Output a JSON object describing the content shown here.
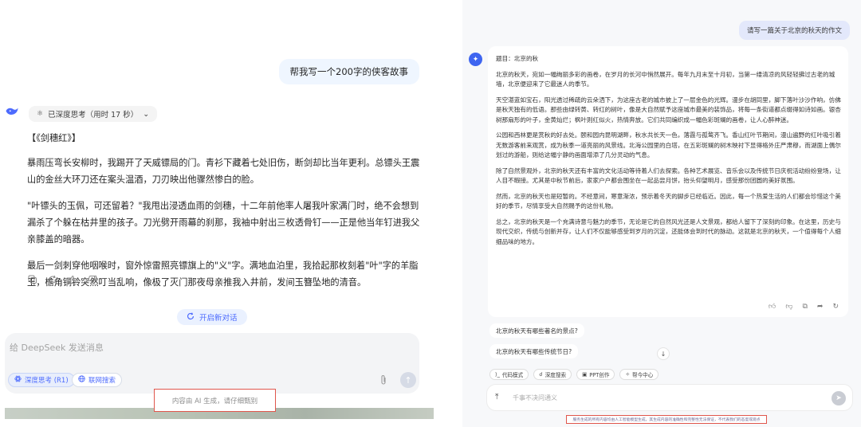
{
  "left": {
    "user_message": "帮我写一个200字的侠客故事",
    "think_chip": {
      "icon": "atom-icon",
      "label": "已深度思考（用时 17 秒）",
      "chevron": "⌄"
    },
    "answer": {
      "title": "【《剑穗红》】",
      "paragraphs": [
        "暴雨压弯长安柳时，我踢开了天威镖局的门。青衫下藏着七处旧伤，断剑却比当年更利。总镖头王震山的金丝大环刀还在案头温酒，刀刃映出他骤然惨白的脸。",
        "\"叶镖头的玉佩，可还留着？\"我甩出浸透血雨的剑穗，十二年前他率人屠我叶家满门时，绝不会想到漏杀了个躲在枯井里的孩子。刀光劈开雨幕的刹那，我袖中射出三枚透骨钉——正是他当年钉进我父亲膝盖的暗器。",
        "最后一剑刺穿他咽喉时，窗外惊雷照亮镖旗上的\"义\"字。满地血泊里，我拾起那枚刻着\"叶\"字的羊脂玉，檐角铜铃突然叮当乱响，像极了灭门那夜母亲推我入井前，发间玉簪坠地的清音。"
      ]
    },
    "actions": [
      "copy-icon",
      "regenerate-icon",
      "thumbs-up-icon",
      "thumbs-down-icon"
    ],
    "new_chat_label": "开启新对话",
    "composer": {
      "placeholder": "给 DeepSeek 发送消息",
      "deep_think_label": "深度思考 (R1)",
      "web_search_label": "联网搜索"
    },
    "disclaimer": "内容由 AI 生成，请仔细甄别"
  },
  "right": {
    "user_message": "请写一篇关于北京的秋天的作文",
    "paragraphs": [
      "题目：北京的秋",
      "北京的秋天，宛如一幅绚丽多彩的画卷，在岁月的长河中悄然展开。每年九月末至十月初，当第一缕清凉的风轻轻拂过古老的城墙，北京便迎来了它最迷人的季节。",
      "天空湛蓝如宝石，阳光透过稀疏的云朵洒下，为这座古老的城市披上了一层金色的光辉。漫步在胡同里，脚下落叶沙沙作响，仿佛是秋天独有的低语。那些由绿转黄、转红的树叶，像是大自然赋予这座城市最美的装饰品，将每一条街道都点缀得如诗如画。银杏树那扇形的叶子，金黄灿烂；枫叶则红似火，热情奔放。它们共同编织成一幅色彩斑斓的画卷，让人心醉神迷。",
      "公园和西林更是赏秋的好去处。颐和园内昆明湖畔，秋水共长天一色，落霞与孤鹜齐飞。香山红叶节期间，漫山遍野的红叶吸引着无数游客前来观赏，成为秋季一道亮丽的风景线。北海公园里的白塔，在五彩斑斓的树木映衬下显得格外庄严肃穆，而湖面上偶尔划过的游船，则给这幅宁静的画面增添了几分灵动的气息。",
      "除了自然景观外，北京的秋天还有丰富的文化活动等待着人们去探索。各种艺术展览、音乐会以及传统节日庆祝活动纷纷登场，让人目不暇接。尤其是中秋节前后，家家户户都会围坐在一起品尝月饼，抬头仰望明月，感受那份团圆的美好氛围。",
      "然而，北京的秋天也是短暂的。不经意间，寒意渐浓，预示着冬天的脚步已经临近。因此，每一个热爱生活的人们都会珍惜这个美好的季节，尽情享受大自然赐予的这份礼物。",
      "总之，北京的秋天是一个充满诗意与魅力的季节，无论是它的自然风光还是人文景观，都给人留下了深刻的印象。在这里，历史与现代交织，传统与创新并存，让人们不仅能够感受到岁月的沉淀，还能体会到时代的脉动。这就是北京的秋天，一个值得每个人细细品味的地方。"
    ],
    "actions": [
      "thumbs-up-icon",
      "thumbs-down-icon",
      "copy-icon",
      "share-icon",
      "regenerate-icon"
    ],
    "suggestions": [
      "北京的秋天有哪些著名的景点?",
      "北京的秋天有哪些传统节日?"
    ],
    "tools": [
      {
        "icon": "code-icon",
        "label": "代码模式"
      },
      {
        "icon": "search-icon",
        "label": "深度搜索"
      },
      {
        "icon": "ppt-icon",
        "label": "PPT创作"
      },
      {
        "icon": "magic-icon",
        "label": "帮今中心"
      }
    ],
    "input_placeholder": "千事不决问通义",
    "disclaimer": "服务生成的所有内容均由人工智能模型生成，其生成内容的准确性和完整性无法保证，不代表我们的态度或观点"
  }
}
